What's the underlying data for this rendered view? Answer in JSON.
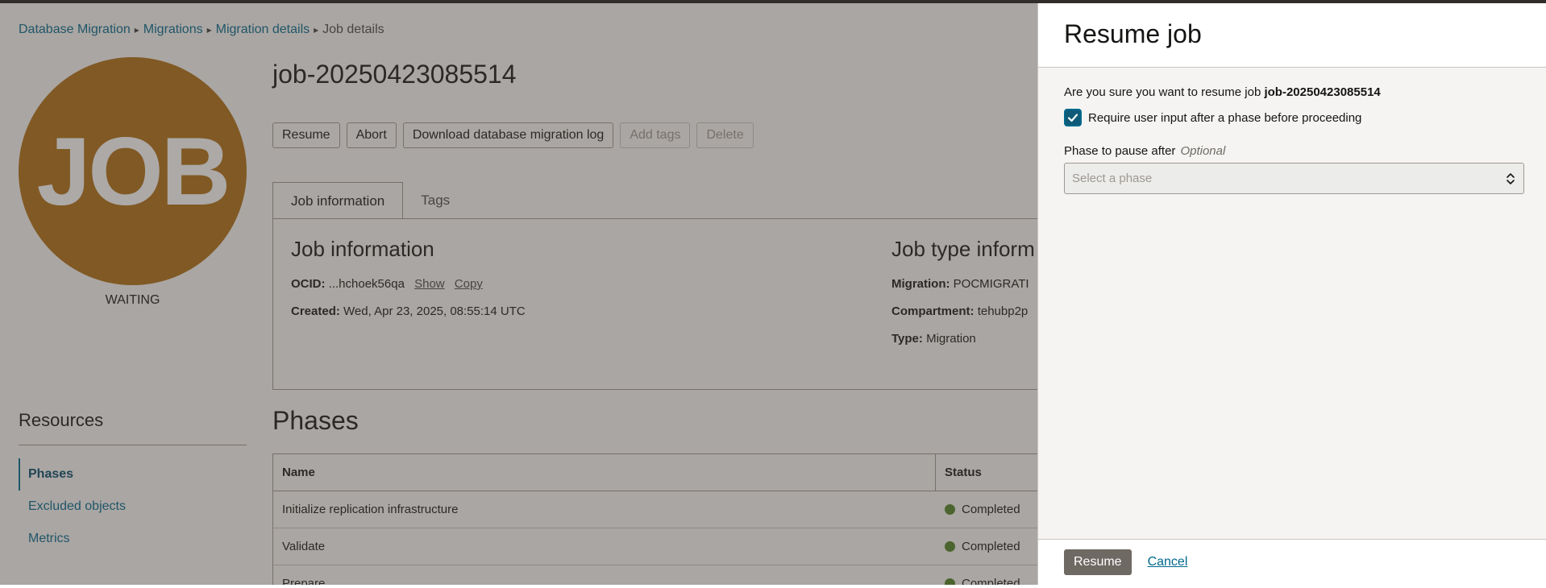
{
  "breadcrumb": {
    "items": [
      "Database Migration",
      "Migrations",
      "Migration details"
    ],
    "current": "Job details"
  },
  "job": {
    "icon_text": "JOB",
    "icon_color": "#b06d11",
    "state": "WAITING",
    "title": "job-20250423085514"
  },
  "actions": {
    "resume": "Resume",
    "abort": "Abort",
    "download_log": "Download database migration log",
    "add_tags": "Add tags",
    "delete": "Delete"
  },
  "tabs": [
    "Job information",
    "Tags"
  ],
  "job_info": {
    "title": "Job information",
    "ocid_label": "OCID:",
    "ocid_value": "...hchoek56qa",
    "show": "Show",
    "copy": "Copy",
    "created_label": "Created:",
    "created_value": "Wed, Apr 23, 2025, 08:55:14 UTC"
  },
  "job_type_info": {
    "title": "Job type inform",
    "migration_label": "Migration:",
    "migration_value": "POCMIGRATI",
    "compartment_label": "Compartment:",
    "compartment_value": "tehubp2p",
    "type_label": "Type:",
    "type_value": "Migration"
  },
  "resources": {
    "title": "Resources",
    "items": [
      "Phases",
      "Excluded objects",
      "Metrics"
    ]
  },
  "phases": {
    "title": "Phases",
    "columns": [
      "Name",
      "Status"
    ],
    "rows": [
      {
        "name": "Initialize replication infrastructure",
        "status": "Completed"
      },
      {
        "name": "Validate",
        "status": "Completed"
      },
      {
        "name": "Prepare",
        "status": "Completed"
      }
    ],
    "status_color": "#508223"
  },
  "drawer": {
    "title": "Resume job",
    "confirm_prefix": "Are you sure you want to resume job",
    "confirm_job": "job-20250423085514",
    "checkbox_label": "Require user input after a phase before proceeding",
    "checkbox_checked": true,
    "phase_label": "Phase to pause after",
    "phase_optional": "Optional",
    "phase_placeholder": "Select a phase",
    "resume_button": "Resume",
    "cancel_link": "Cancel"
  }
}
